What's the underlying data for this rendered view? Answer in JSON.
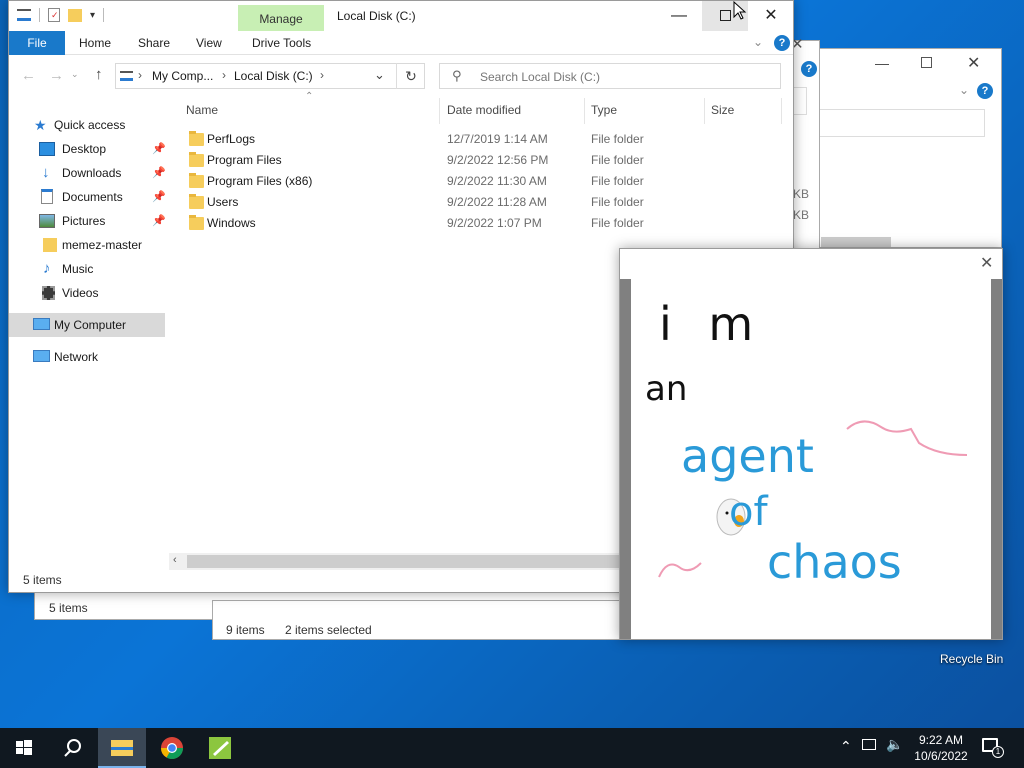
{
  "desktop": {
    "recycle_bin_label": "Recycle Bin"
  },
  "main_window": {
    "title": "Local Disk (C:)",
    "ribbon_tabs": {
      "file": "File",
      "home": "Home",
      "share": "Share",
      "view": "View",
      "drive_tools": "Drive Tools",
      "manage": "Manage"
    },
    "address": {
      "seg1": "My Comp...",
      "seg2": "Local Disk (C:)"
    },
    "search_placeholder": "Search Local Disk (C:)",
    "sidebar": {
      "quick_access": "Quick access",
      "desktop": "Desktop",
      "downloads": "Downloads",
      "documents": "Documents",
      "pictures": "Pictures",
      "memez": "memez-master",
      "music": "Music",
      "videos": "Videos",
      "my_computer": "My Computer",
      "network": "Network"
    },
    "columns": {
      "name": "Name",
      "date": "Date modified",
      "type": "Type",
      "size": "Size"
    },
    "rows": [
      {
        "name": "PerfLogs",
        "date": "12/7/2019 1:14 AM",
        "type": "File folder"
      },
      {
        "name": "Program Files",
        "date": "9/2/2022 12:56 PM",
        "type": "File folder"
      },
      {
        "name": "Program Files (x86)",
        "date": "9/2/2022 11:30 AM",
        "type": "File folder"
      },
      {
        "name": "Users",
        "date": "9/2/2022 11:28 AM",
        "type": "File folder"
      },
      {
        "name": "Windows",
        "date": "9/2/2022 1:07 PM",
        "type": "File folder"
      }
    ],
    "status_items": "5 items"
  },
  "back_window_2": {
    "status_items": "5 items",
    "size_kb_1": "KB",
    "size_kb_2": "KB"
  },
  "back_window_1": {
    "status_items": "9 items",
    "status_selected": "2 items selected"
  },
  "paint_window": {
    "drawing_lines": [
      "i m",
      "an",
      "agent",
      "of",
      "chaos"
    ],
    "colors": {
      "black": "#111111",
      "blue": "#2a9ad8",
      "pink": "#ef9bb4"
    }
  },
  "taskbar": {
    "time": "9:22 AM",
    "date": "10/6/2022",
    "notification_count": "1"
  },
  "colors": {
    "accent": "#1979ca",
    "manage_tab": "#c8efb4",
    "taskbar": "#101820"
  }
}
